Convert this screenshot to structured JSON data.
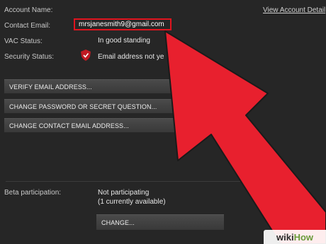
{
  "account": {
    "name_label": "Account Name:",
    "view_details_link": "View Account Detail",
    "email_label": "Contact Email:",
    "email_value": "mrsjanesmith9@gmail.com",
    "vac_label": "VAC Status:",
    "vac_value": "In good standing",
    "security_label": "Security Status:",
    "security_icon": "shield-icon",
    "security_value": "Email address not ye"
  },
  "buttons": {
    "verify_email": "VERIFY EMAIL ADDRESS...",
    "change_password": "CHANGE PASSWORD OR SECRET QUESTION...",
    "change_email": "CHANGE CONTACT EMAIL ADDRESS..."
  },
  "beta": {
    "label": "Beta participation:",
    "status": "Not participating",
    "available": "(1 currently available)",
    "change_button": "CHANGE..."
  },
  "watermark": {
    "wiki": "wiki",
    "how": "How"
  },
  "colors": {
    "background": "#262626",
    "highlight_border": "#e0141e",
    "arrow": "#e8202e"
  }
}
